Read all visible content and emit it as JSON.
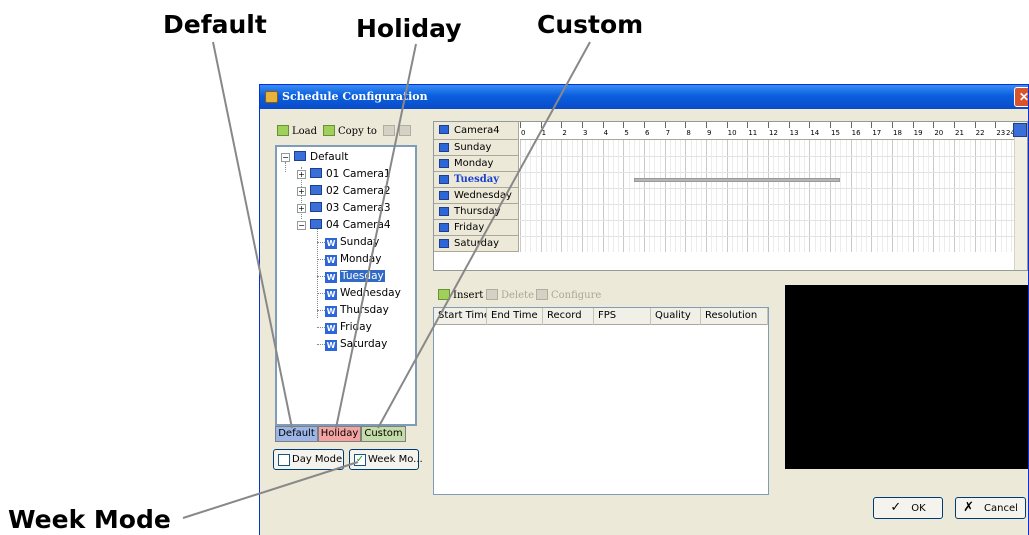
{
  "callouts": {
    "default": "Default",
    "holiday": "Holiday",
    "custom": "Custom",
    "week_mode": "Week Mode"
  },
  "window": {
    "title": "Schedule Configuration",
    "close_glyph": "✕"
  },
  "left_toolbar": {
    "load": "Load",
    "copy_to": "Copy to"
  },
  "tree": {
    "root": "Default",
    "cameras": [
      "01 Camera1",
      "02 Camera2",
      "03 Camera3",
      "04 Camera4"
    ],
    "days": [
      "Sunday",
      "Monday",
      "Tuesday",
      "Wednesday",
      "Thursday",
      "Friday",
      "Saturday"
    ],
    "selected_day": "Tuesday",
    "expand_plus": "+",
    "expand_minus": "−",
    "day_icon_letter": "W"
  },
  "tabs": {
    "default": "Default",
    "holiday": "Holiday",
    "custom": "Custom"
  },
  "mode_buttons": {
    "day_mode": "Day Mode",
    "week_mode": "Week Mo...",
    "check": "✓"
  },
  "schedule": {
    "camera_header": "Camera4",
    "days": [
      "Sunday",
      "Monday",
      "Tuesday",
      "Wednesday",
      "Thursday",
      "Friday",
      "Saturday"
    ],
    "highlighted_day": "Tuesday",
    "hours": [
      "0",
      "1",
      "2",
      "3",
      "4",
      "5",
      "6",
      "7",
      "8",
      "9",
      "10",
      "11",
      "12",
      "13",
      "14",
      "15",
      "16",
      "17",
      "18",
      "19",
      "20",
      "21",
      "22",
      "23",
      "24"
    ],
    "tuesday_bar_hours": [
      5.5,
      15.5
    ]
  },
  "lower_toolbar": {
    "insert": "Insert",
    "delete": "Delete",
    "configure": "Configure"
  },
  "list_columns": [
    "Start Time",
    "End Time",
    "Record",
    "FPS",
    "Quality",
    "Resolution"
  ],
  "dialog_buttons": {
    "ok": "OK",
    "ok_mark": "✓",
    "cancel": "Cancel",
    "cancel_mark": "✗"
  }
}
